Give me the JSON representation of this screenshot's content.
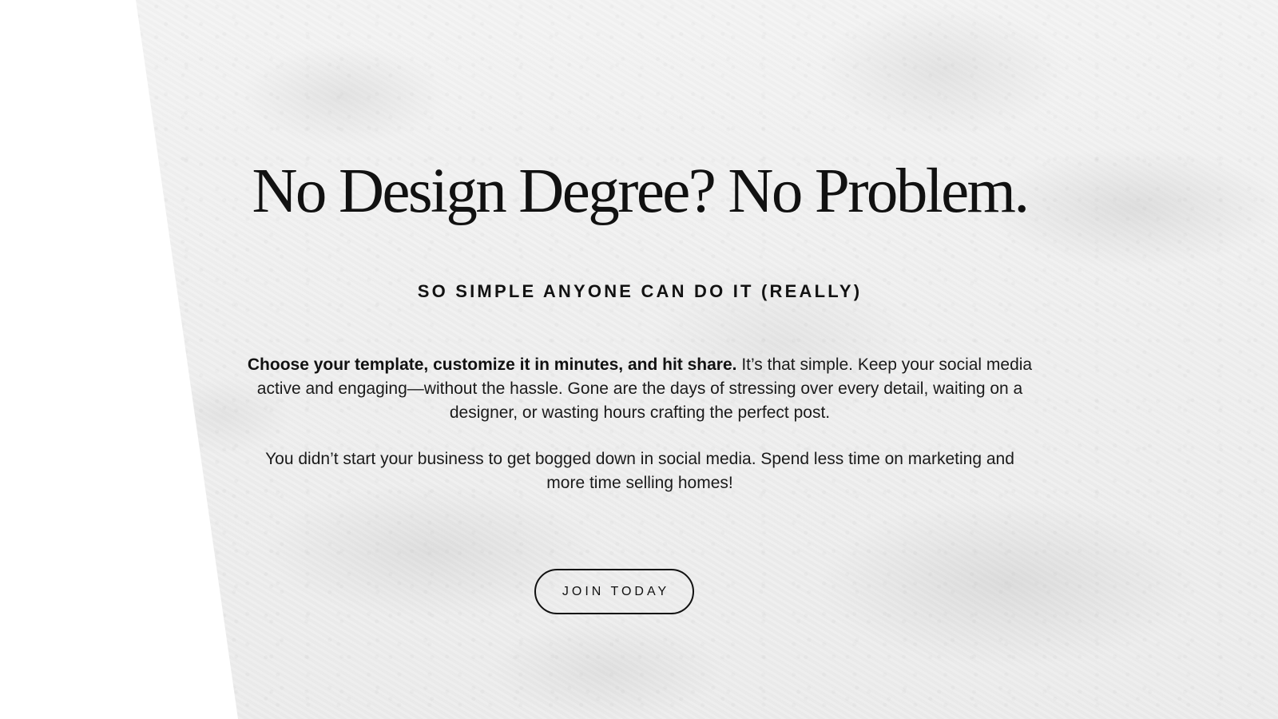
{
  "hero": {
    "headline": "No Design Degree? No Problem.",
    "subheading": "SO SIMPLE ANYONE CAN DO IT (REALLY)",
    "paragraph_1_lead": "Choose your template, customize it in minutes, and hit share.",
    "paragraph_1_rest": "It’s that simple. Keep your social media active and engaging—without the hassle. Gone are the days of stressing over every detail, waiting on a designer, or wasting hours crafting the perfect post.",
    "paragraph_2": "You didn’t start your business to get bogged down in social media. Spend less time on marketing and more time selling homes!",
    "cta_label": "JOIN TODAY"
  },
  "theme": {
    "background": "#ffffff",
    "panel": "#efefef",
    "text": "#111111"
  }
}
